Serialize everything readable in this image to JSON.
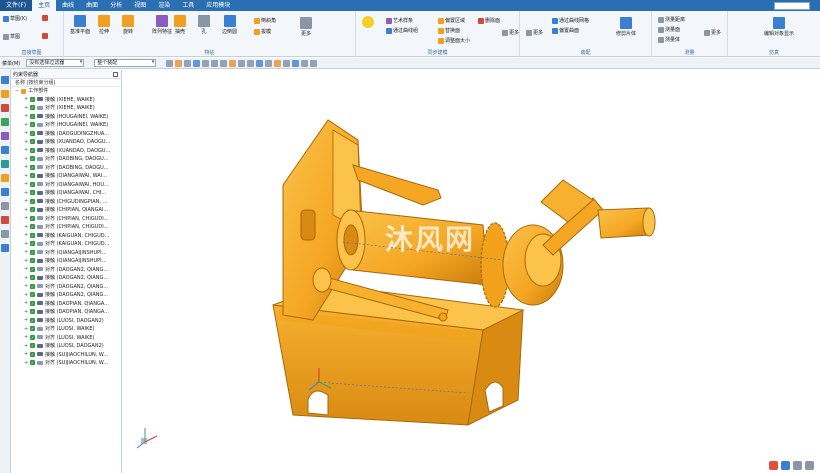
{
  "menubar": {
    "file": "文件(F)",
    "tabs": [
      "主页",
      "曲线",
      "曲面",
      "分析",
      "视图",
      "渲染",
      "工具",
      "应用模块"
    ]
  },
  "ribbon": {
    "groups": [
      {
        "label": "直接草图",
        "items": [
          "草图(K)",
          "草图"
        ]
      },
      {
        "label": "特征",
        "items": [
          "基准平面",
          "拉伸",
          "旋转",
          "阵列特征",
          "抽壳",
          "孔",
          "边倒圆",
          "倒斜角",
          "拔模",
          "更多"
        ]
      },
      {
        "label": "同步建模",
        "items": [
          "艺术样条",
          "通过曲线组",
          "偏置区域",
          "替换面",
          "删除面",
          "调整面大小",
          "更多"
        ]
      },
      {
        "label": "装配",
        "items": [
          "通过曲线网格",
          "偏置曲面",
          "修剪片体",
          "更多"
        ]
      },
      {
        "label": "测量",
        "items": [
          "测量距离",
          "测量面",
          "测量体",
          "更多"
        ]
      },
      {
        "label": "仿真",
        "items": [
          "编辑对象显示"
        ]
      }
    ]
  },
  "toolbar": {
    "menu_label": "菜单(M)",
    "filter": "没有选择过滤器",
    "scope": "整个装配"
  },
  "navigator": {
    "title": "约束导航器",
    "column": "名称 (按约束分组)",
    "root": "工作部件",
    "items": [
      {
        "type": "接触",
        "name": "接触 (XIEHE, WAIKE)"
      },
      {
        "type": "对齐",
        "name": "对齐 (XIEHE, WAIKE)"
      },
      {
        "type": "接触",
        "name": "接触 (HOUGAINEI, WAIKE)"
      },
      {
        "type": "对齐",
        "name": "对齐 (HOUGAINEI, WAIKE)"
      },
      {
        "type": "接触",
        "name": "接触 (DAOGUDINGZHUA..."
      },
      {
        "type": "接触",
        "name": "接触 (XUANDAO, DAOGU..."
      },
      {
        "type": "接触",
        "name": "接触 (XUANDAO, DAOGU..."
      },
      {
        "type": "对齐",
        "name": "对齐 (DAOBING, DAOGU..."
      },
      {
        "type": "对齐",
        "name": "对齐 (DAOBING, DAOGU..."
      },
      {
        "type": "接触",
        "name": "接触 (QIANGAIWAI, WAI..."
      },
      {
        "type": "对齐",
        "name": "对齐 (QIANGAIWAI, HOU..."
      },
      {
        "type": "接触",
        "name": "接触 (QIANGAIWAI, CHI..."
      },
      {
        "type": "接触",
        "name": "接触 (CHIGUDINGPIAN, ..."
      },
      {
        "type": "接触",
        "name": "接触 (CHIPIAN, QIANGAI..."
      },
      {
        "type": "对齐",
        "name": "对齐 (CHIPIAN, CHIGUDI..."
      },
      {
        "type": "对齐",
        "name": "对齐 (CHIPIAN, CHIGUDI..."
      },
      {
        "type": "接触",
        "name": "接触 (KAIGUAN, CHIGUD..."
      },
      {
        "type": "对齐",
        "name": "对齐 (KAIGUAN, CHIGUD..."
      },
      {
        "type": "对齐",
        "name": "对齐 (QIANGAIJINSHUPI..."
      },
      {
        "type": "接触",
        "name": "接触 (QIANGAIJINSHUPI..."
      },
      {
        "type": "对齐",
        "name": "对齐 (DAOGAN2, QIANG..."
      },
      {
        "type": "接触",
        "name": "接触 (DAOGAN2, QIANG..."
      },
      {
        "type": "对齐",
        "name": "对齐 (DAOGAN2, QIANG..."
      },
      {
        "type": "接触",
        "name": "接触 (DAOGAN2, QIANG..."
      },
      {
        "type": "接触",
        "name": "接触 (DAOPIAN, QIANGA..."
      },
      {
        "type": "接触",
        "name": "接触 (DAOPIAN, QIANGA..."
      },
      {
        "type": "接触",
        "name": "接触 (LUOSI, DAOGAN2)"
      },
      {
        "type": "对齐",
        "name": "对齐 (LUOSI, WAIKE)"
      },
      {
        "type": "对齐",
        "name": "对齐 (LUOSI, WAIKE)"
      },
      {
        "type": "接触",
        "name": "接触 (LUOSI, DAOGAN2)"
      },
      {
        "type": "接触",
        "name": "接触 (SUIJIAOCHILUN, W..."
      },
      {
        "type": "对齐",
        "name": "对齐 (SUIJIAOCHILUN, W..."
      }
    ]
  },
  "viewport": {
    "watermark": "沐风网",
    "model_color": "#f5a623",
    "model_shade": "#c97d0a"
  },
  "colors": {
    "menubar": "#2a6fb2",
    "ribbon_bg": "#f3f6fa",
    "check": "#2f9a3e"
  }
}
